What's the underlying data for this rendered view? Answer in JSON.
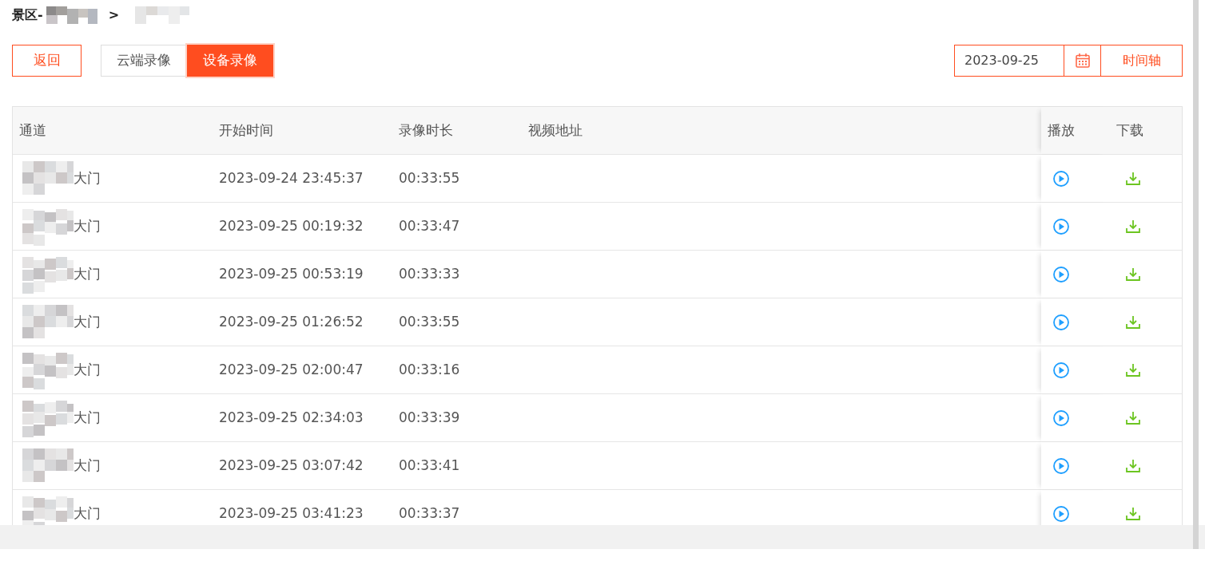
{
  "breadcrumb": {
    "prefix": "景区-",
    "separator": ">"
  },
  "toolbar": {
    "back_button": "返回",
    "tabs": [
      {
        "label": "云端录像",
        "selected": false
      },
      {
        "label": "设备录像",
        "selected": true
      }
    ],
    "date_field": {
      "value": "2023-09-25"
    },
    "timeline_button": "时间轴"
  },
  "table": {
    "columns": [
      "通道",
      "开始时间",
      "录像时长",
      "视频地址",
      "播放",
      "下载"
    ],
    "rows": [
      {
        "channel": "大门",
        "start": "2023-09-24 23:45:37",
        "duration": "00:33:55"
      },
      {
        "channel": "大门",
        "start": "2023-09-25 00:19:32",
        "duration": "00:33:47"
      },
      {
        "channel": "大门",
        "start": "2023-09-25 00:53:19",
        "duration": "00:33:33"
      },
      {
        "channel": "大门",
        "start": "2023-09-25 01:26:52",
        "duration": "00:33:55"
      },
      {
        "channel": "大门",
        "start": "2023-09-25 02:00:47",
        "duration": "00:33:16"
      },
      {
        "channel": "大门",
        "start": "2023-09-25 02:34:03",
        "duration": "00:33:39"
      },
      {
        "channel": "大门",
        "start": "2023-09-25 03:07:42",
        "duration": "00:33:41"
      },
      {
        "channel": "大门",
        "start": "2023-09-25 03:41:23",
        "duration": "00:33:37"
      }
    ]
  }
}
